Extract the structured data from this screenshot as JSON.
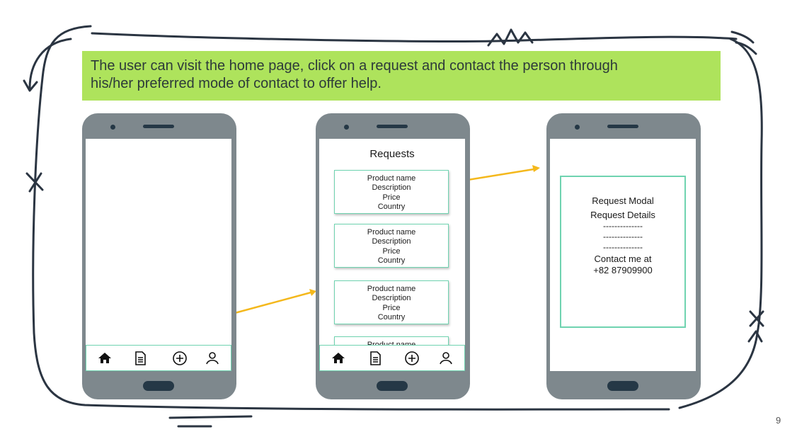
{
  "banner": {
    "line1": "The user can visit the home page, click on a request and contact the person through",
    "line2": "his/her preferred mode of contact to offer help."
  },
  "requests_screen": {
    "title": "Requests",
    "cards": [
      {
        "lines": [
          "Product name",
          "Description",
          "Price",
          "Country"
        ]
      },
      {
        "lines": [
          "Product name",
          "Description",
          "Price",
          "Country"
        ]
      },
      {
        "lines": [
          "Product name",
          "Description",
          "Price",
          "Country"
        ]
      },
      {
        "lines": [
          "Product name"
        ]
      }
    ]
  },
  "modal_screen": {
    "title": "Request Modal",
    "subtitle": "Request Details",
    "divider1": "--------------",
    "divider2": "--------------",
    "divider3": "--------------",
    "contact_line1": "Contact me at",
    "contact_line2": "+82 87909900"
  },
  "nav_icons": [
    "home-icon",
    "document-icon",
    "add-icon",
    "profile-icon"
  ],
  "colors": {
    "banner": "#aee35c",
    "phone_body": "#7e888d",
    "phone_dark": "#253846",
    "card_border": "#6fd3b0",
    "highlight": "#f4b81c",
    "sketch_frame": "#2b3542"
  },
  "page_number": "9"
}
